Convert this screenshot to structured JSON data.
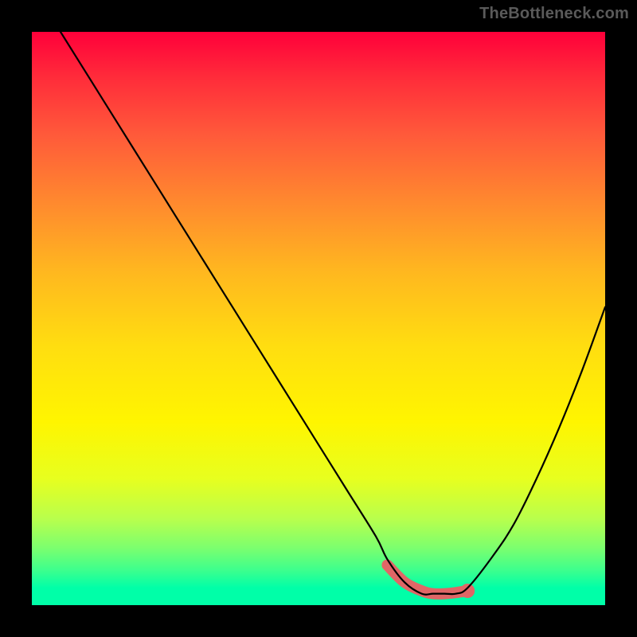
{
  "watermark": "TheBottleneck.com",
  "colors": {
    "background": "#000000",
    "curve": "#000000",
    "highlight": "#e06666",
    "gradient_top": "#ff003a",
    "gradient_bottom": "#00ffa8"
  },
  "chart_data": {
    "type": "line",
    "title": "",
    "xlabel": "",
    "ylabel": "",
    "xlim": [
      0,
      100
    ],
    "ylim": [
      0,
      100
    ],
    "grid": false,
    "legend": false,
    "series": [
      {
        "name": "bottleneck-curve",
        "x": [
          0,
          5,
          10,
          15,
          20,
          25,
          30,
          35,
          40,
          45,
          50,
          55,
          60,
          62,
          65,
          68,
          70,
          72,
          74,
          76,
          80,
          84,
          88,
          92,
          96,
          100
        ],
        "values": [
          108,
          100,
          92,
          84,
          76,
          68,
          60,
          52,
          44,
          36,
          28,
          20,
          12,
          8,
          4,
          2,
          2,
          2,
          2,
          3,
          8,
          14,
          22,
          31,
          41,
          52
        ]
      }
    ],
    "highlight": {
      "x": [
        62,
        65,
        68,
        70,
        72,
        74,
        76
      ],
      "values": [
        7,
        4,
        2.5,
        2,
        2,
        2.2,
        2.5
      ],
      "end_dot": {
        "x": 76,
        "y": 2.5
      }
    }
  }
}
